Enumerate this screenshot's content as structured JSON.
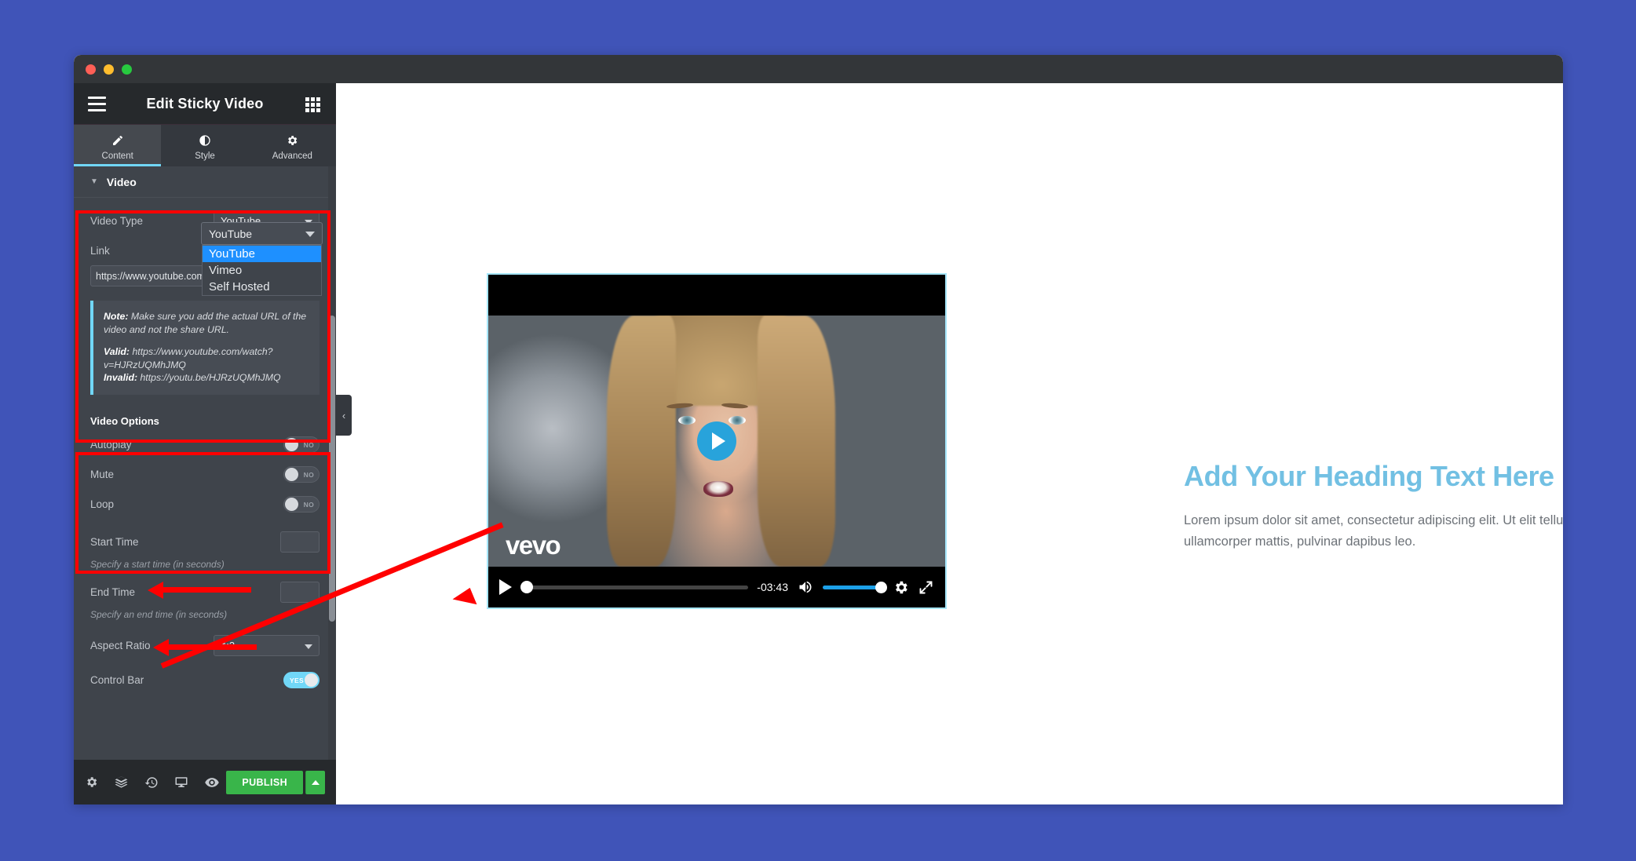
{
  "window": {
    "title_buttons": [
      "close",
      "minimize",
      "maximize"
    ]
  },
  "panel": {
    "title": "Edit Sticky Video",
    "menu_icon": "hamburger-icon",
    "apps_icon": "grid-icon",
    "tabs": [
      {
        "label": "Content",
        "icon": "pencil-icon",
        "active": true
      },
      {
        "label": "Style",
        "icon": "contrast-icon",
        "active": false
      },
      {
        "label": "Advanced",
        "icon": "gear-icon",
        "active": false
      }
    ],
    "section": {
      "label": "Video",
      "caret": "▼"
    },
    "video_type": {
      "label": "Video Type",
      "value": "YouTube",
      "options": [
        "YouTube",
        "Vimeo",
        "Self Hosted"
      ],
      "selected_index": 0
    },
    "link": {
      "label": "Link",
      "value": "https://www.youtube.com/watch?v=1RNKG",
      "dynamic_icon": "dynamic-tags-icon"
    },
    "note": {
      "line1_label": "Note:",
      "line1_text": " Make sure you add the actual URL of the video and not the share URL.",
      "valid_label": "Valid:",
      "valid_text": " https://www.youtube.com/watch?v=HJRzUQMhJMQ",
      "invalid_label": "Invalid:",
      "invalid_text": " https://youtu.be/HJRzUQMhJMQ"
    },
    "video_options": {
      "title": "Video Options",
      "items": [
        {
          "label": "Autoplay",
          "state": "NO",
          "on": false
        },
        {
          "label": "Mute",
          "state": "NO",
          "on": false
        },
        {
          "label": "Loop",
          "state": "NO",
          "on": false
        }
      ]
    },
    "start_time": {
      "label": "Start Time",
      "value": "",
      "hint": "Specify a start time (in seconds)"
    },
    "end_time": {
      "label": "End Time",
      "value": "",
      "hint": "Specify an end time (in seconds)"
    },
    "aspect_ratio": {
      "label": "Aspect Ratio",
      "value": "4:3"
    },
    "control_bar": {
      "label": "Control Bar",
      "state": "YES",
      "on": true
    },
    "footer": {
      "icons": [
        "gear-icon",
        "layers-icon",
        "history-icon",
        "responsive-icon",
        "preview-eye-icon"
      ],
      "publish_label": "PUBLISH",
      "publish_caret": "caret-up-icon"
    },
    "collapse_handle": "‹"
  },
  "preview": {
    "video": {
      "play_overlay": "play-icon",
      "brand_logo": "vevo",
      "controls": {
        "play": "play-icon",
        "time_remaining": "-03:43",
        "volume_icon": "speaker-icon",
        "settings_icon": "gear-icon",
        "fullscreen_icon": "expand-icon"
      }
    },
    "heading": "Add Your Heading Text Here",
    "paragraph": "Lorem ipsum dolor sit amet, consectetur adipiscing elit. Ut elit tellus, luctus nec ullamcorper mattis, pulvinar dapibus leo."
  },
  "colors": {
    "desktop_bg": "#4054b8",
    "panel_bg": "#3f444b",
    "accent_blue": "#71d7f7",
    "publish_green": "#39b54a",
    "annotation_red": "#ff0000",
    "heading_blue": "#72c0e3",
    "dropdown_highlight": "#1e90ff"
  }
}
